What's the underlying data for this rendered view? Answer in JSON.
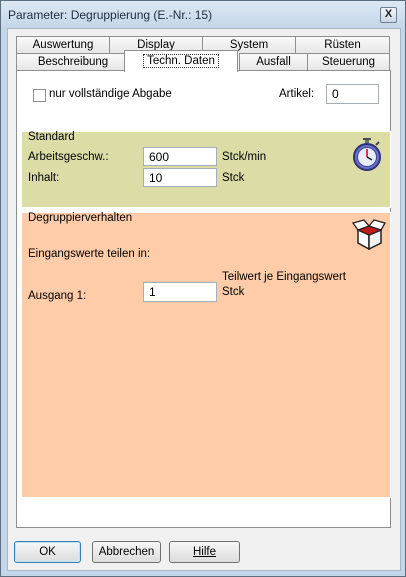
{
  "window": {
    "title": "Parameter: Degruppierung (E.-Nr.: 15)",
    "close_glyph": "X"
  },
  "tabs": {
    "row1": [
      "Auswertung",
      "Display",
      "System",
      "Rüsten"
    ],
    "row2": [
      "Beschreibung",
      "Techn. Daten",
      "Ausfall",
      "Steuerung"
    ],
    "active": "Techn. Daten"
  },
  "top": {
    "checkbox_label": "nur vollständige Abgabe",
    "checkbox_checked": false,
    "artikel_label": "Artikel:",
    "artikel_value": "0"
  },
  "standard": {
    "title": "Standard",
    "speed_label": "Arbeitsgeschw.:",
    "speed_value": "600",
    "speed_unit": "Stck/min",
    "content_label": "Inhalt:",
    "content_value": "10",
    "content_unit": "Stck",
    "icon": "stopwatch-icon"
  },
  "degroup": {
    "title": "Degruppierverhalten",
    "split_label": "Eingangswerte teilen in:",
    "part_label": "Teilwert je Eingangswert",
    "output_label": "Ausgang 1:",
    "output_value": "1",
    "output_unit": "Stck",
    "icon": "open-box-icon"
  },
  "buttons": {
    "ok": "OK",
    "cancel": "Abbrechen",
    "help": "Hilfe"
  },
  "colors": {
    "standard_bg": "#dcdca6",
    "degroup_bg": "#fecca8"
  }
}
